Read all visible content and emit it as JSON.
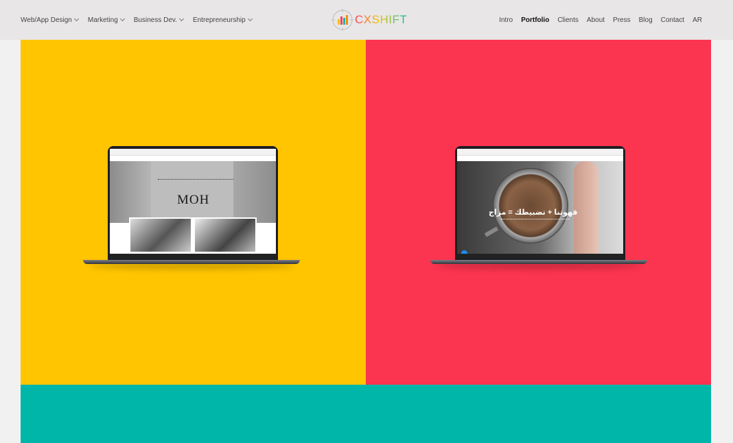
{
  "header": {
    "left_nav": [
      {
        "label": "Web/App Design",
        "has_dropdown": true
      },
      {
        "label": "Marketing",
        "has_dropdown": true
      },
      {
        "label": "Business Dev.",
        "has_dropdown": true
      },
      {
        "label": "Entrepreneurship",
        "has_dropdown": true
      }
    ],
    "logo_text": "CXSHIFT",
    "right_nav": [
      {
        "label": "Intro",
        "active": false
      },
      {
        "label": "Portfolio",
        "active": true
      },
      {
        "label": "Clients",
        "active": false
      },
      {
        "label": "About",
        "active": false
      },
      {
        "label": "Press",
        "active": false
      },
      {
        "label": "Blog",
        "active": false
      },
      {
        "label": "Contact",
        "active": false
      },
      {
        "label": "AR",
        "active": false
      }
    ]
  },
  "portfolio": {
    "tiles": [
      {
        "color": "#fec500",
        "screen_text": "MOH"
      },
      {
        "color": "#fb344f",
        "screen_text": "قهوتنا + تضبيطك = مزاج"
      },
      {
        "color": "#00b6a8"
      }
    ]
  },
  "colors": {
    "header_bg": "#e8e6e6",
    "page_bg": "#f2f1f1",
    "logo_gradient": [
      "#f2c500",
      "#ff3b5c",
      "#12b8ad"
    ]
  }
}
